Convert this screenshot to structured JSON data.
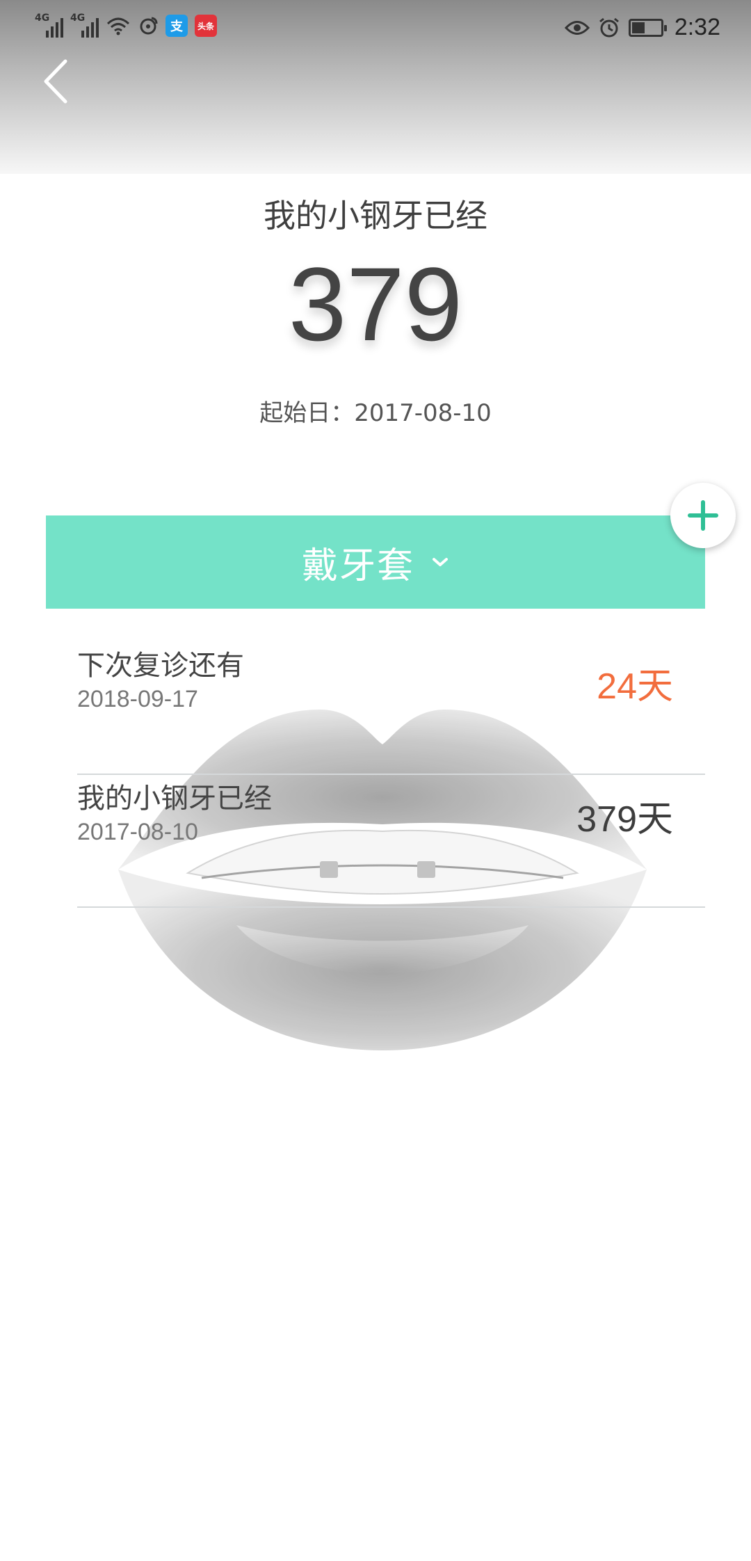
{
  "status_bar": {
    "signal1_label": "4G",
    "signal2_label": "4G",
    "app_badge_1": "支",
    "app_badge_2": "头条",
    "time": "2:32"
  },
  "header": {
    "title": "我的小钢牙已经",
    "count": "379",
    "start_date": "起始日：2017-08-10"
  },
  "mode_selector": {
    "label": "戴牙套"
  },
  "list": [
    {
      "label": "下次复诊还有",
      "date": "2018-09-17",
      "value": "24天"
    },
    {
      "label": "我的小钢牙已经",
      "date": "2017-08-10",
      "value": "379天"
    }
  ],
  "colors": {
    "accent_mint": "#74e2c8",
    "highlight_orange": "#f26d3d",
    "plus_green": "#2fbf95"
  }
}
